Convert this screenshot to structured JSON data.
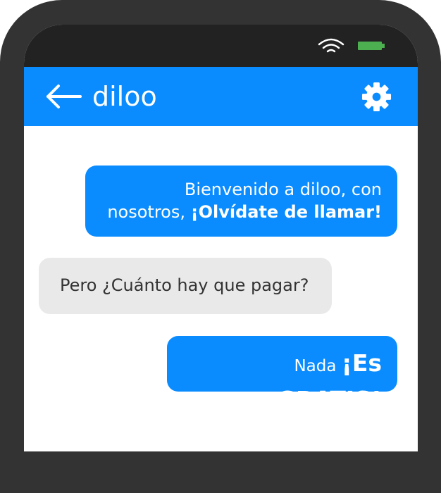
{
  "app": {
    "title": "diloo"
  },
  "icons": {
    "back": "arrow-left-icon",
    "settings": "gear-icon",
    "wifi": "wifi-icon",
    "battery": "battery-icon"
  },
  "colors": {
    "accent": "#0a8cff",
    "frame": "#333333",
    "status_bar": "#222222",
    "received_bubble": "#e9e9e9",
    "battery": "#4caf50"
  },
  "messages": [
    {
      "direction": "sent",
      "line1": "Bienvenido a diloo, con",
      "line2_normal": "nosotros, ",
      "line2_bold": "¡Olvídate de llamar!"
    },
    {
      "direction": "received",
      "text": "Pero ¿Cuánto hay que pagar?"
    },
    {
      "direction": "sent",
      "text_normal": "Nada ",
      "text_bold": "¡Es GRATIS!"
    }
  ]
}
